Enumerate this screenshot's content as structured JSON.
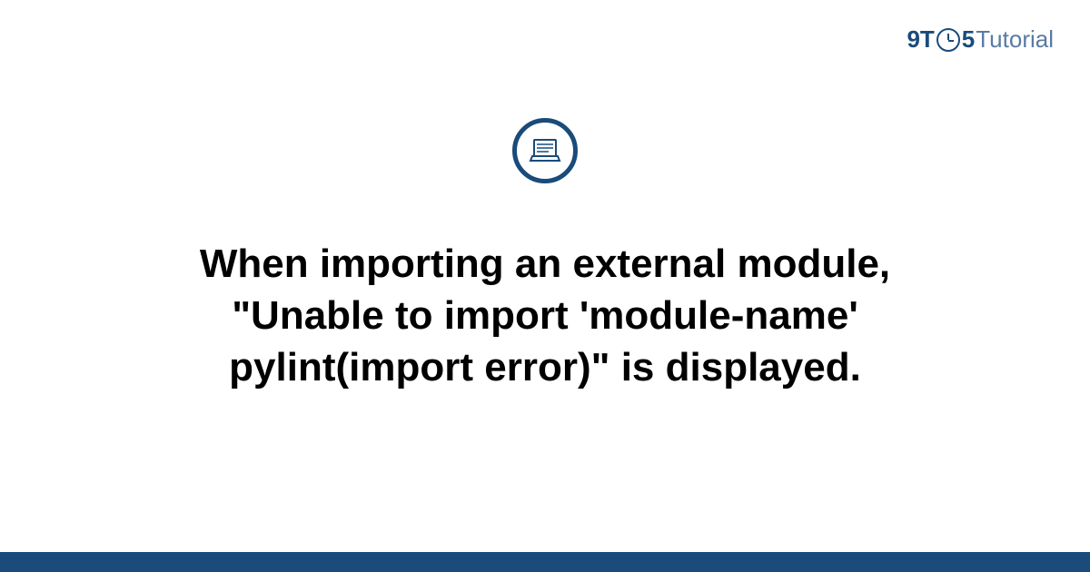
{
  "logo": {
    "part1": "9T",
    "part2": "5",
    "part3": "Tutorial"
  },
  "title": "When importing an external module, \"Unable to import 'module-name' pylint(import error)\" is displayed.",
  "colors": {
    "brand_primary": "#1a4b7a",
    "brand_secondary": "#5a7ba3"
  }
}
